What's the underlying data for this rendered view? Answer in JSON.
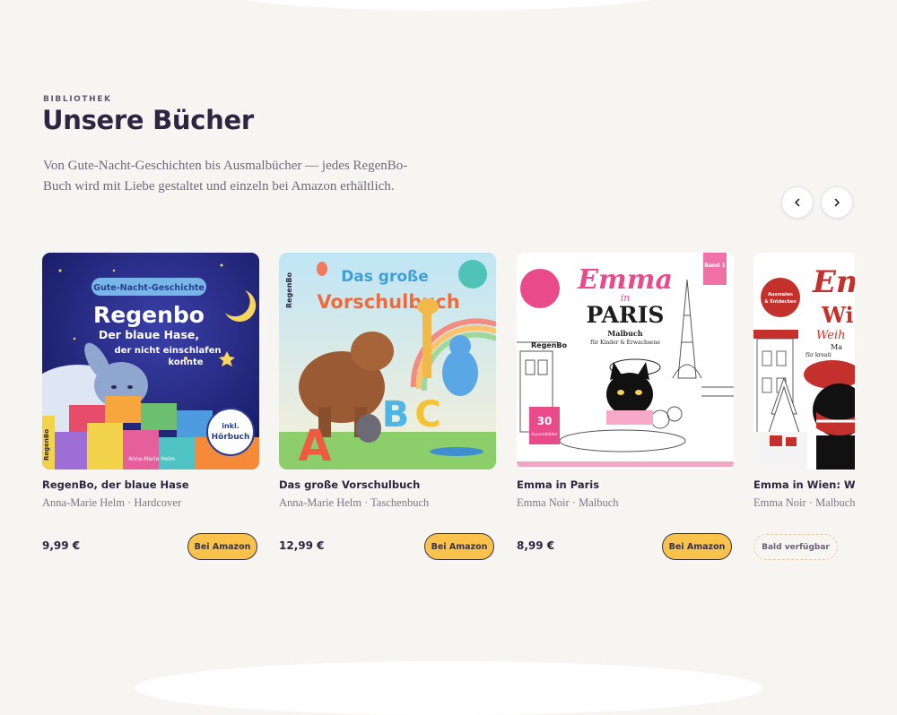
{
  "section": {
    "eyebrow": "BIBLIOTHEK",
    "title": "Unsere Bücher",
    "intro": "Von Gute-Nacht-Geschichten bis Ausmalbücher — jedes RegenBo-Buch wird mit Liebe gestaltet und einzeln bei Amazon erhältlich."
  },
  "carousel": {
    "prev_icon": "chevron-left-icon",
    "next_icon": "chevron-right-icon"
  },
  "books": [
    {
      "title": "RegenBo, der blaue Hase",
      "meta": "Anna-Marie Helm · Hardcover",
      "price": "9,99 €",
      "action": "Bei Amazon",
      "cover": {
        "banner": "Gute-Nacht-Geschichte",
        "heading": "Regenbo",
        "subtitle_1": "Der blaue Hase,",
        "subtitle_2": "der nicht einschlafen",
        "subtitle_3": "konnte",
        "publisher": "RegenBo",
        "author": "Anna-Marie Helm",
        "badge_1": "inkl.",
        "badge_2": "Hörbuch"
      }
    },
    {
      "title": "Das große Vorschulbuch",
      "meta": "Anna-Marie Helm · Taschenbuch",
      "price": "12,99 €",
      "action": "Bei Amazon",
      "cover": {
        "heading_1": "Das große",
        "heading_2": "Vorschulbuch",
        "publisher": "RegenBo",
        "letter_a": "A",
        "letter_b": "B",
        "letter_c": "C"
      }
    },
    {
      "title": "Emma in Paris",
      "meta": "Emma Noir · Malbuch",
      "price": "8,99 €",
      "action": "Bei Amazon",
      "cover": {
        "heading_1": "Emma",
        "heading_2": "in",
        "heading_3": "PARIS",
        "subtitle_1": "Malbuch",
        "subtitle_2": "für Kinder & Erwachsene",
        "band": "Band 1",
        "sticker_1": "30",
        "sticker_2": "Ausmalbilder",
        "publisher": "RegenBo"
      }
    },
    {
      "title": "Emma in Wien: Weihnachten",
      "meta": "Emma Noir · Malbuch",
      "price": "",
      "action": "Bald verfügbar",
      "cover": {
        "heading_1": "Em",
        "heading_2": "Wi",
        "heading_3": "Weih",
        "subtitle_1": "Ma",
        "subtitle_2": "für kreati",
        "sticker_1": "Ausmalen",
        "sticker_2": "& Entdecken"
      }
    }
  ],
  "colors": {
    "background": "#f7f5f2",
    "title": "#2c2640",
    "button": "#f9c24a",
    "button_border": "#3a3248"
  }
}
